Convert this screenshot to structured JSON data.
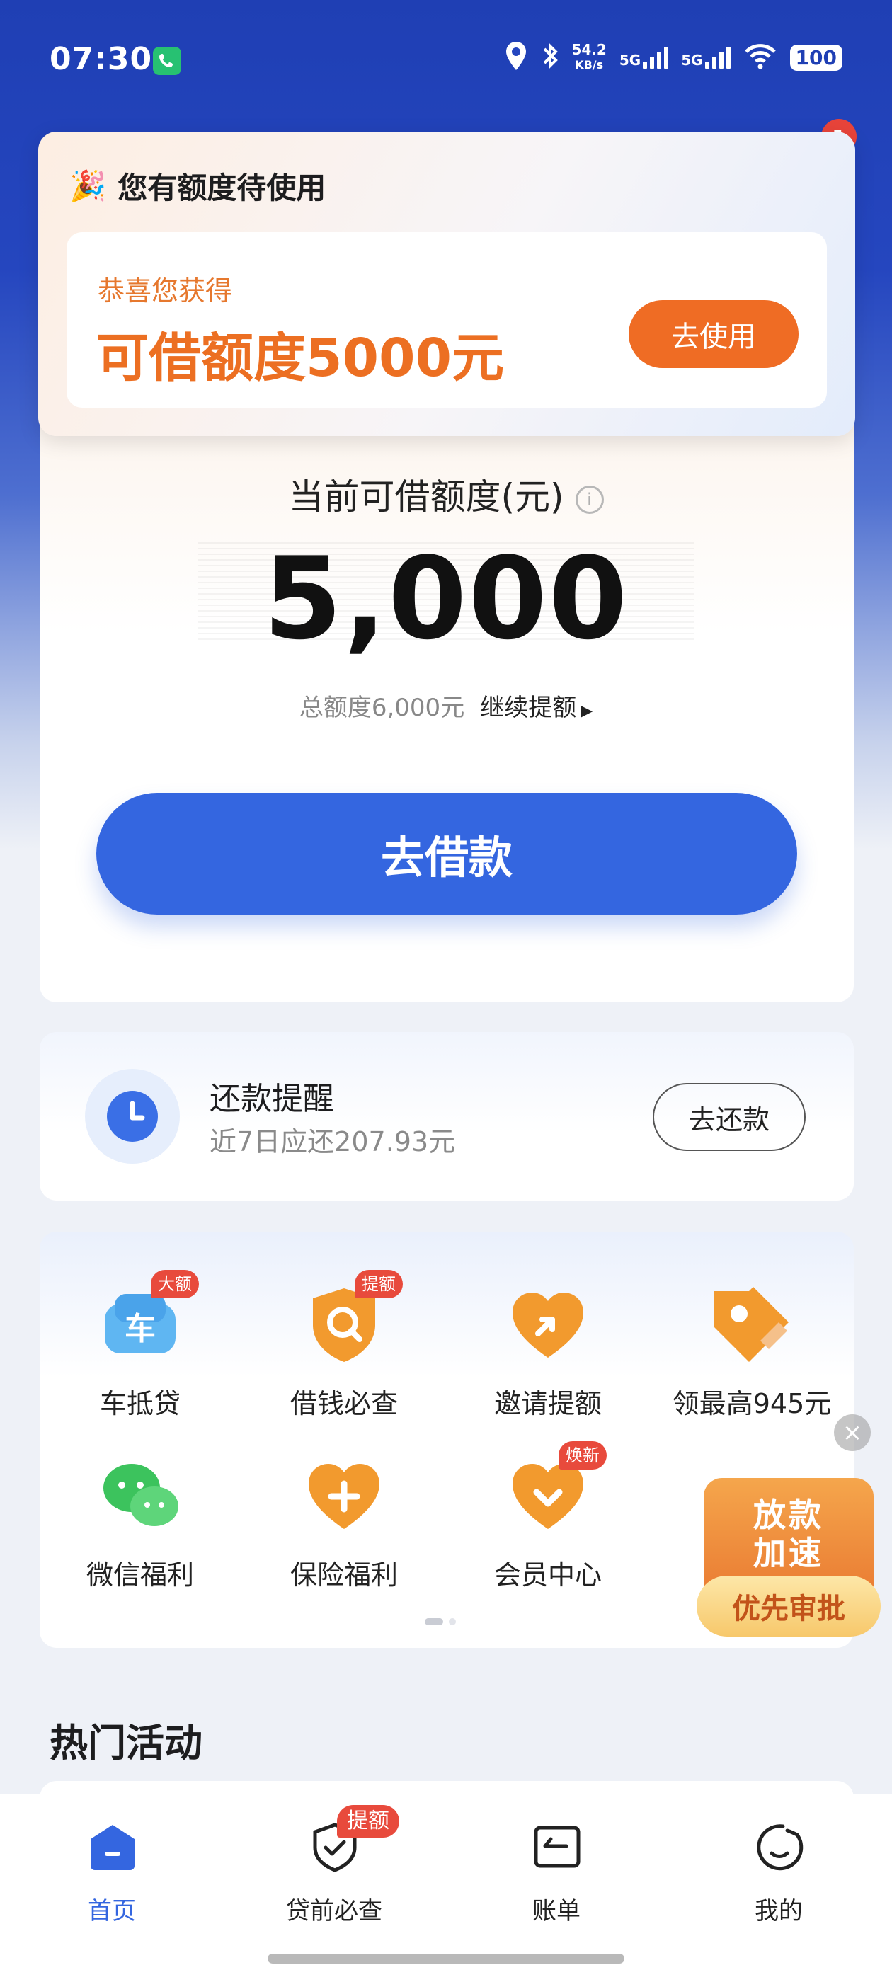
{
  "status_bar": {
    "time": "07:30",
    "net_speed_value": "54.2",
    "net_speed_unit": "KB/s",
    "sim1": "5G",
    "sim2": "5G",
    "battery": "100"
  },
  "popup": {
    "header_emoji": "🎉",
    "header": "您有额度待使用",
    "congrats": "恭喜您获得",
    "quota": "可借额度5000元",
    "use_button": "去使用",
    "notification_count": "1"
  },
  "credit": {
    "label": "当前可借额度(元)",
    "info_symbol": "i",
    "amount": "5,000",
    "total": "总额度6,000元",
    "raise_link": "继续提额",
    "borrow_button": "去借款"
  },
  "repayment": {
    "title": "还款提醒",
    "subtitle": "近7日应还207.93元",
    "button": "去还款"
  },
  "services": [
    {
      "label": "车抵贷",
      "tag": "大额",
      "icon": "car-loan-icon"
    },
    {
      "label": "借钱必查",
      "tag": "提额",
      "icon": "search-shield-icon"
    },
    {
      "label": "邀请提额",
      "tag": "",
      "icon": "invite-heart-icon"
    },
    {
      "label": "领最高945元",
      "tag": "",
      "icon": "coupon-tag-icon"
    },
    {
      "label": "微信福利",
      "tag": "",
      "icon": "wechat-icon"
    },
    {
      "label": "保险福利",
      "tag": "",
      "icon": "insurance-heart-icon"
    },
    {
      "label": "会员中心",
      "tag": "焕新",
      "icon": "member-heart-icon"
    }
  ],
  "pager": {
    "pages": 2,
    "active": 1
  },
  "float_ad": {
    "line1": "放款",
    "line2": "加速",
    "pill": "优先审批",
    "close_symbol": "×"
  },
  "hot": {
    "title": "热门活动"
  },
  "tabs": [
    {
      "label": "首页",
      "active": true,
      "icon": "home-icon"
    },
    {
      "label": "贷前必查",
      "active": false,
      "icon": "shield-check-icon",
      "tag": "提额"
    },
    {
      "label": "账单",
      "active": false,
      "icon": "bill-icon"
    },
    {
      "label": "我的",
      "active": false,
      "icon": "profile-icon"
    }
  ],
  "colors": {
    "primary": "#3466e0",
    "accent_orange": "#ef6c24",
    "badge_red": "#e84a3c",
    "header_blue": "#1f3fb4"
  }
}
